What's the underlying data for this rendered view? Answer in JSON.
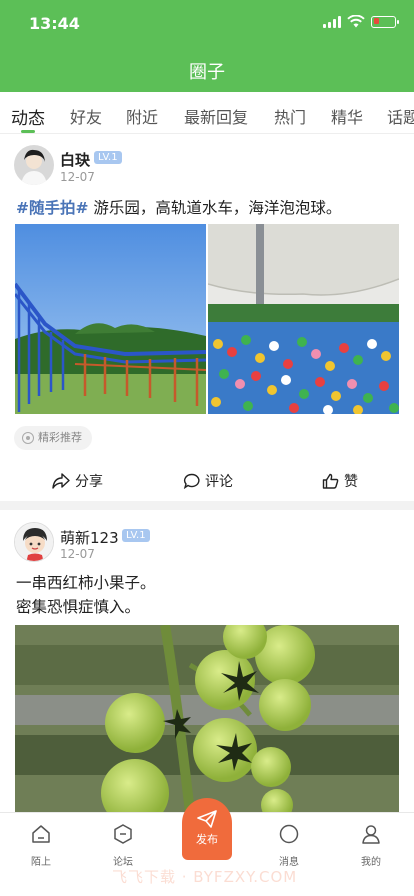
{
  "status_bar": {
    "time": "13:44"
  },
  "header": {
    "title": "圈子"
  },
  "tabs": [
    {
      "label": "动态",
      "active": true
    },
    {
      "label": "好友"
    },
    {
      "label": "附近"
    },
    {
      "label": "最新回复"
    },
    {
      "label": "热门"
    },
    {
      "label": "精华"
    },
    {
      "label": "话题"
    }
  ],
  "posts": [
    {
      "username": "白玦",
      "level": "LV.1",
      "date": "12-07",
      "hashtag": "#随手拍#",
      "text": " 游乐园，高轨道水车，海洋泡泡球。",
      "photos": [
        "roller-coaster-photo",
        "ball-pit-photo"
      ],
      "recommend_label": "精彩推荐",
      "actions": {
        "share": "分享",
        "comment": "评论",
        "like": "赞"
      }
    },
    {
      "username": "萌新123",
      "level": "LV.1",
      "date": "12-07",
      "lines": [
        "一串西红柿小果子。",
        "密集恐惧症慎入。"
      ],
      "photos": [
        "tomato-photo"
      ]
    }
  ],
  "bottom_nav": {
    "items": [
      {
        "label": "陌上",
        "icon": "home-icon"
      },
      {
        "label": "论坛",
        "icon": "forum-icon"
      },
      {
        "label": "发布",
        "icon": "paper-plane-icon"
      },
      {
        "label": "消息",
        "icon": "message-icon"
      },
      {
        "label": "我的",
        "icon": "profile-icon"
      }
    ]
  },
  "watermark": "飞飞下载 · BYFZXY.COM",
  "colors": {
    "brand_green": "#5cbf57",
    "publish_orange": "#f06b3c",
    "hashtag_blue": "#4a74b7",
    "level_badge": "#a8c7f0"
  }
}
